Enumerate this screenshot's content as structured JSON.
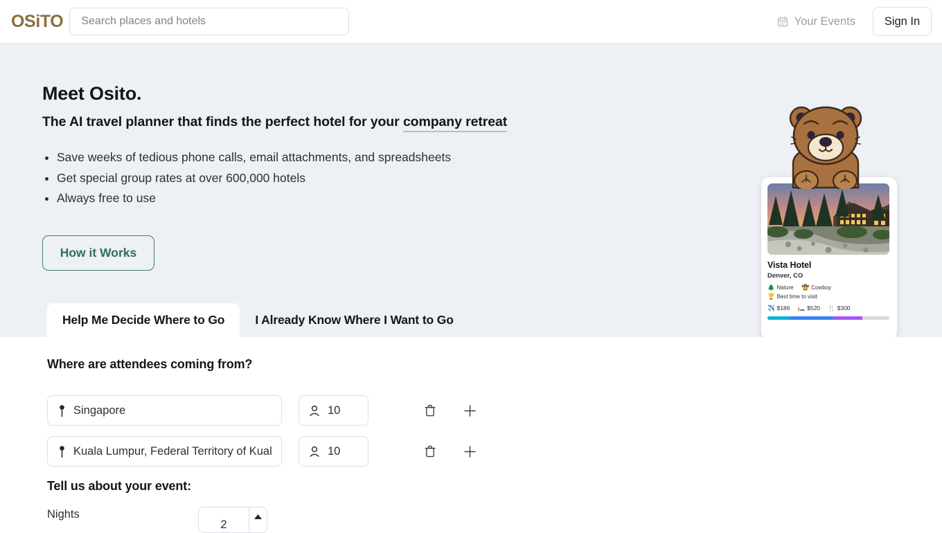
{
  "header": {
    "logo": "OSiTO",
    "logo_color": "#8a6f3d",
    "search": {
      "placeholder": "Search places and hotels",
      "value": "",
      "icon": "search-icon"
    },
    "your_events": {
      "label": "Your Events",
      "icon": "calendar-icon"
    },
    "sign_in": "Sign In"
  },
  "hero": {
    "background_color": "#edf0f4",
    "title": "Meet Osito.",
    "subtitle_prefix": "The AI travel planner that finds the perfect hotel for your ",
    "subtitle_link": "company retreat",
    "bullets": [
      "Save weeks of tedious phone calls, email attachments, and spreadsheets",
      "Get special group rates at over 600,000 hotels",
      "Always free to use"
    ],
    "cta": {
      "label": "How it Works",
      "color": "#2f6b63"
    },
    "mascot": "bear-mascot-icon"
  },
  "hotel_card": {
    "photo_alt": "mountain-lodge-sunset-photo",
    "name": "Vista Hotel",
    "location": "Denver, CO",
    "tags": [
      {
        "icon": "tree-icon",
        "label": "Nature"
      },
      {
        "icon": "cowboy-hat-icon",
        "label": "Cowboy"
      },
      {
        "icon": "trophy-icon",
        "label": "Best time to visit"
      }
    ],
    "prices": [
      {
        "icon": "airplane-icon",
        "label": "$186"
      },
      {
        "icon": "bed-icon",
        "label": "$520"
      },
      {
        "icon": "fork-knife-icon",
        "label": "$300"
      }
    ],
    "score_bar": {
      "segments": [
        {
          "color": "#06b6d4",
          "pct": 18
        },
        {
          "color": "#3b82f6",
          "pct": 36
        },
        {
          "color": "#a855f7",
          "pct": 24
        }
      ],
      "track_color": "#d6d8dc"
    }
  },
  "tabs": [
    {
      "label": "Help Me Decide Where to Go",
      "active": true
    },
    {
      "label": "I Already Know Where I Want to Go",
      "active": false
    }
  ],
  "form": {
    "attendees_question": "Where are attendees coming from?",
    "origins": [
      {
        "city": "Singapore",
        "count": "10",
        "pin_icon": "map-pin-icon",
        "person_icon": "person-icon",
        "delete_icon": "trash-icon",
        "add_icon": "plus-icon"
      },
      {
        "city": "Kuala Lumpur, Federal Territory of Kual",
        "count": "10",
        "pin_icon": "map-pin-icon",
        "person_icon": "person-icon",
        "delete_icon": "trash-icon",
        "add_icon": "plus-icon"
      }
    ],
    "event_question": "Tell us about your event:",
    "nights_label": "Nights",
    "nights_value": "2",
    "nights_up_icon": "caret-up-icon"
  }
}
